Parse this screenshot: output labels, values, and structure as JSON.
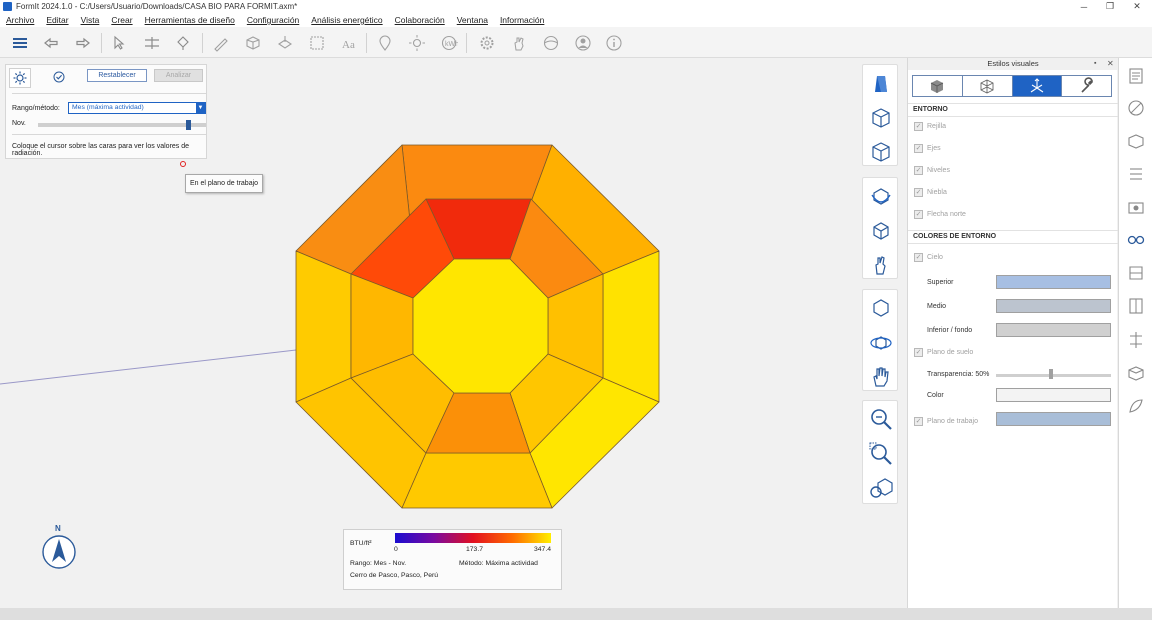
{
  "window": {
    "title": "FormIt 2024.1.0 - C:/Users/Usuario/Downloads/CASA BIO PARA FORMIT.axm*",
    "minimize": "─",
    "maximize": "❐",
    "close": "✕"
  },
  "menu": {
    "items": [
      "Archivo",
      "Editar",
      "Vista",
      "Crear",
      "Herramientas de diseño",
      "Configuración",
      "Análisis energético",
      "Colaboración",
      "Ventana",
      "Información"
    ]
  },
  "radiation_panel": {
    "reset_button": "Restablecer",
    "analyze_button": "Analizar",
    "range_label": "Rango/método:",
    "range_value": "Mes (máxima actividad)",
    "month_label": "Nov.",
    "month_slider_fraction": 0.9,
    "hint": "Coloque el cursor sobre las caras para ver los valores de radiación."
  },
  "tooltip": "En el plano de trabajo",
  "legend": {
    "unit": "BTU/ft²",
    "min": "0",
    "mid": "173.7",
    "max": "347.4",
    "range": "Rango: Mes - Nov.",
    "method": "Método: Máxima actividad",
    "location": "Cerro de Pasco, Pasco, Perú"
  },
  "compass": {
    "label": "N"
  },
  "visual_styles": {
    "title": "Estilos visuales",
    "pin_icon": "pin-icon",
    "close_icon": "close-icon",
    "environment_header": "ENTORNO",
    "grid": "Rejilla",
    "axes": "Ejes",
    "levels": "Niveles",
    "fog": "Niebla",
    "north_arrow": "Flecha norte",
    "env_colors_header": "COLORES DE ENTORNO",
    "sky": "Cielo",
    "top": "Superior",
    "middle": "Medio",
    "bottom": "Inferior / fondo",
    "ground_plane": "Plano de suelo",
    "transparency": "Transparencia: 50%",
    "color": "Color",
    "workplane": "Plano de trabajo",
    "transparency_fraction": 0.5,
    "colors": {
      "top": "#a7bfe3",
      "middle": "#bcc4cf",
      "bottom": "#d0d0d0",
      "ground": "#f3f3f3",
      "workplane": "#a9bed8",
      "active_tab": "#1f63c4"
    }
  },
  "heatmap_colors": {
    "outer_top": "#fb8a10",
    "outer_tl": "#f98d12",
    "outer_tr": "#ffb000",
    "outer_left": "#ffcb00",
    "outer_right": "#ffe200",
    "outer_bl": "#ffc400",
    "outer_br": "#ffe600",
    "outer_bottom": "#ffc900",
    "mid_top": "#f12a0c",
    "mid_tl": "#ff4a08",
    "mid_tr": "#fb8a10",
    "mid_left": "#ffb700",
    "mid_right": "#ffc000",
    "mid_bl": "#ffbd00",
    "mid_br": "#ffc600",
    "mid_bottom": "#fb9008",
    "center": "#ffe600"
  }
}
